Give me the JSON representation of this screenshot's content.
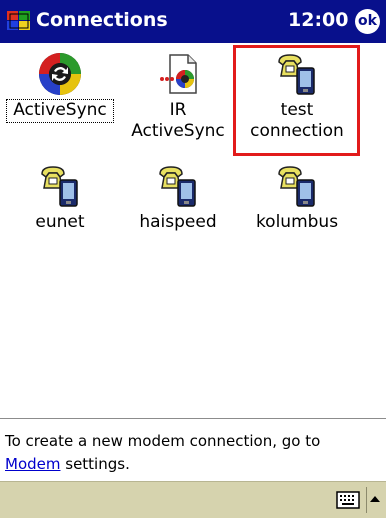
{
  "titlebar": {
    "title": "Connections",
    "time": "12:00",
    "ok_label": "ok"
  },
  "connections": [
    {
      "label_line1": "ActiveSync",
      "label_line2": "",
      "icon": "activesync-icon"
    },
    {
      "label_line1": "IR",
      "label_line2": "ActiveSync",
      "icon": "ir-activesync-icon"
    },
    {
      "label_line1": "test",
      "label_line2": "connection",
      "icon": "modem-connection-icon",
      "selected": true
    },
    {
      "label_line1": "eunet",
      "label_line2": "",
      "icon": "modem-connection-icon"
    },
    {
      "label_line1": "haispeed",
      "label_line2": "",
      "icon": "modem-connection-icon"
    },
    {
      "label_line1": "kolumbus",
      "label_line2": "",
      "icon": "modem-connection-icon"
    }
  ],
  "info": {
    "text_before": "To create a new modem connection, go to",
    "link_text": "Modem",
    "text_after": " settings."
  },
  "menubar": {
    "input_icon": "keyboard-icon",
    "arrow_icon": "up-arrow-icon"
  },
  "colors": {
    "titlebar": "#08108c",
    "selection_border": "#e21b1b",
    "menubar": "#d6d3ae",
    "link": "#0000cc"
  }
}
